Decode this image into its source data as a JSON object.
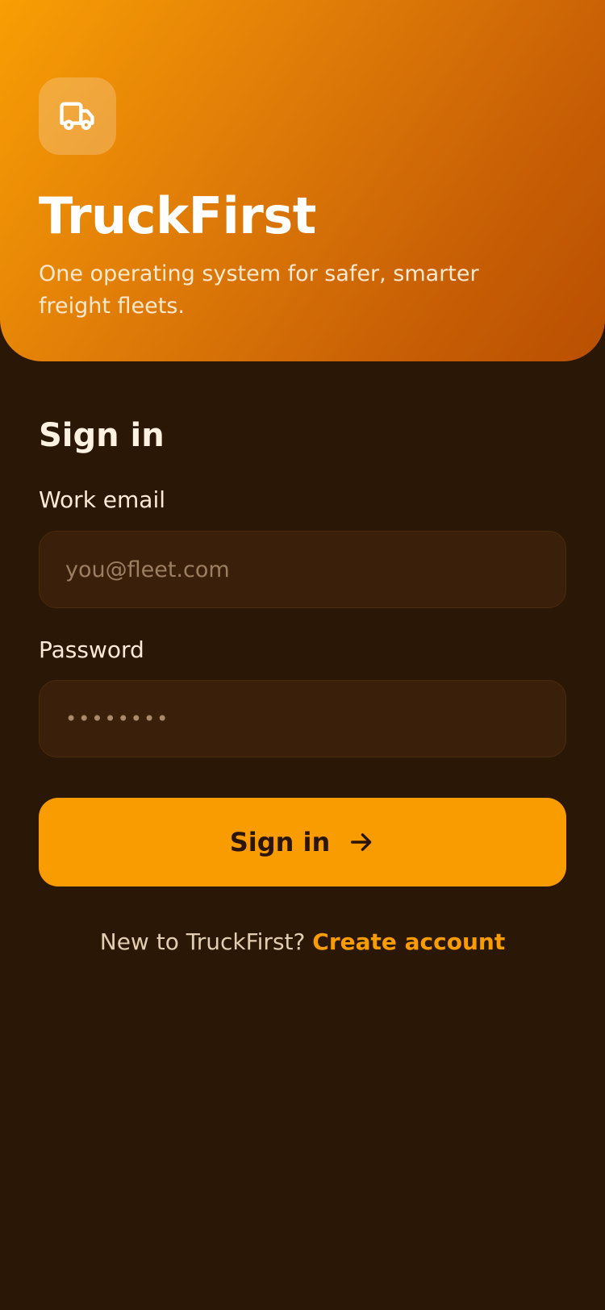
{
  "hero": {
    "app_name": "TruckFirst",
    "tagline": "One operating system for safer, smarter freight fleets.",
    "logo_icon": "truck-icon"
  },
  "form": {
    "title": "Sign in",
    "email": {
      "label": "Work email",
      "placeholder": "you@fleet.com",
      "value": ""
    },
    "password": {
      "label": "Password",
      "value": "••••••••"
    },
    "submit_label": "Sign in",
    "submit_icon": "arrow-right-icon"
  },
  "signup": {
    "prompt": "New to TruckFirst?",
    "link_label": "Create account"
  },
  "colors": {
    "accent": "#f99c02",
    "background": "#2a1706",
    "input_background": "#3a200a",
    "hero_gradient_start": "#f99e04",
    "hero_gradient_end": "#b94f02"
  }
}
